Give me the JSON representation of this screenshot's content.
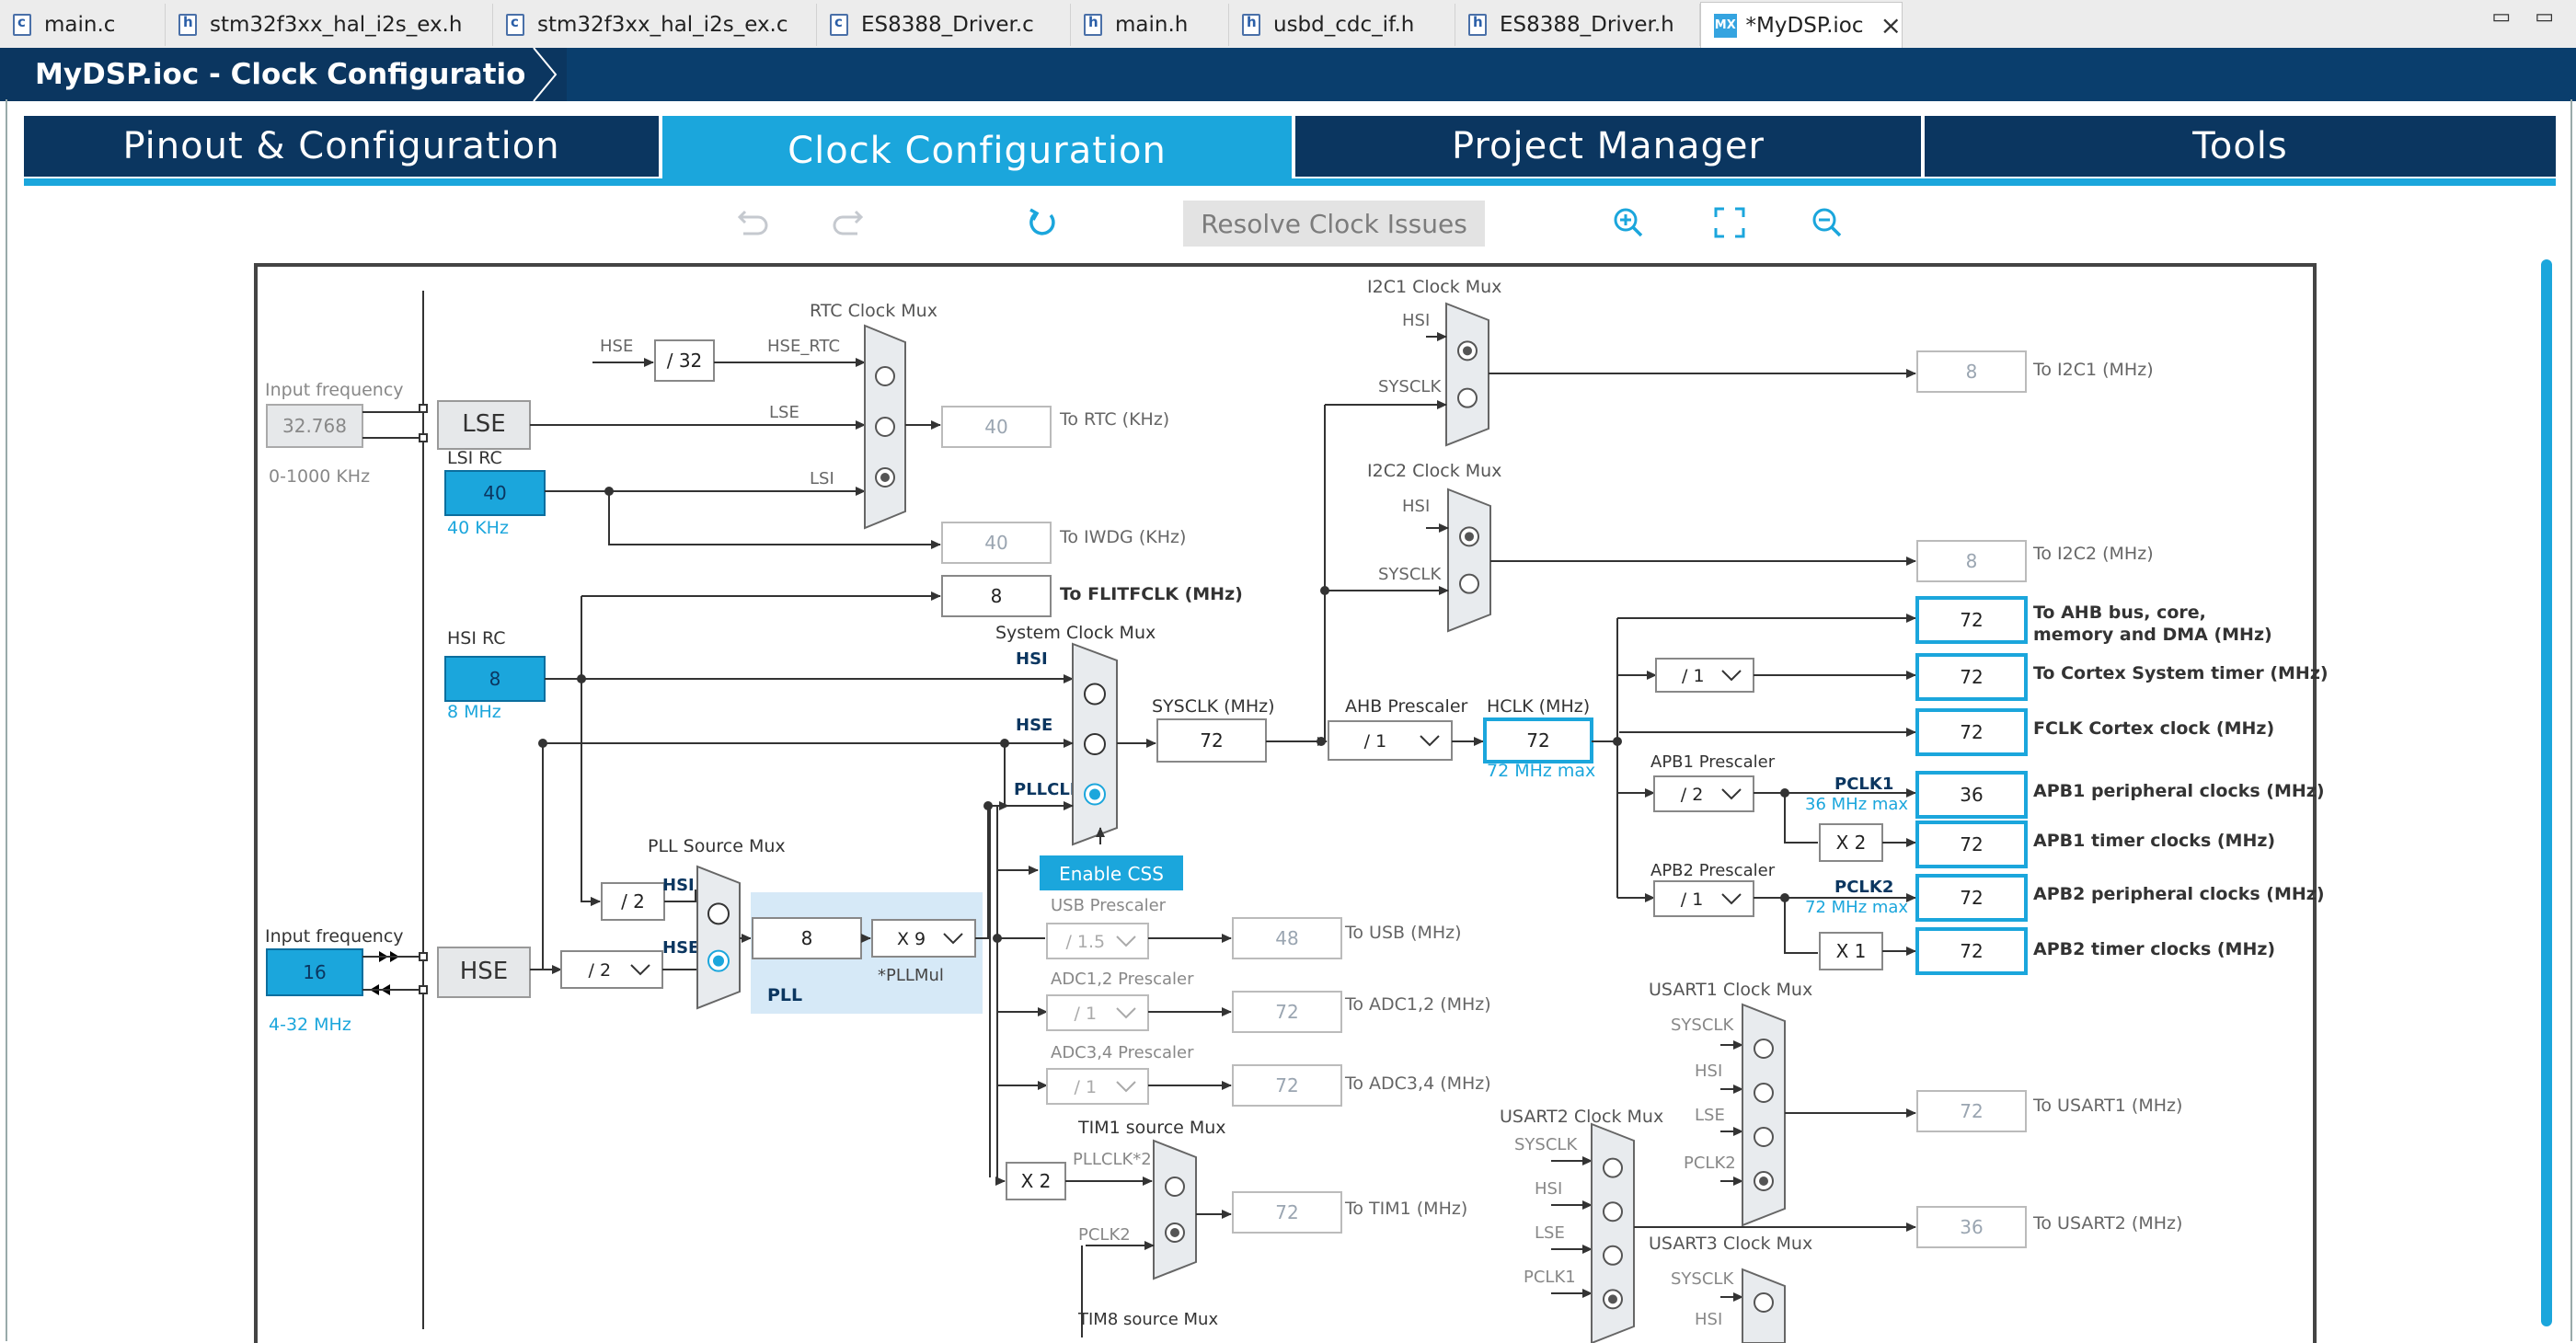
{
  "editor_tabs": [
    {
      "label": "main.c",
      "icon": "c-file-icon"
    },
    {
      "label": "stm32f3xx_hal_i2s_ex.h",
      "icon": "h-file-icon"
    },
    {
      "label": "stm32f3xx_hal_i2s_ex.c",
      "icon": "c-file-icon"
    },
    {
      "label": "ES8388_Driver.c",
      "icon": "c-file-icon"
    },
    {
      "label": "main.h",
      "icon": "h-file-icon"
    },
    {
      "label": "usbd_cdc_if.h",
      "icon": "h-file-icon"
    },
    {
      "label": "ES8388_Driver.h",
      "icon": "h-file-icon"
    },
    {
      "label": "*MyDSP.ioc",
      "icon": "mx-icon",
      "badge": "MX"
    }
  ],
  "breadcrumb": "MyDSP.ioc - Clock Configuration",
  "main_tabs": [
    "Pinout & Configuration",
    "Clock Configuration",
    "Project Manager",
    "Tools"
  ],
  "toolbar": {
    "resolve": "Resolve Clock Issues"
  },
  "colors": {
    "navy": "#0b3660",
    "accent": "#1ba6dc",
    "grey": "#9aa5b1"
  },
  "clock": {
    "input_frequency_label": "Input frequency",
    "lse": {
      "name": "LSE",
      "value": "32.768",
      "range": "0-1000 KHz"
    },
    "lsi": {
      "name": "LSI RC",
      "value": "40",
      "unit": "40 KHz"
    },
    "hsi": {
      "name": "HSI RC",
      "value": "8",
      "unit": "8 MHz"
    },
    "hse": {
      "name": "HSE",
      "value": "16",
      "range": "4-32 MHz"
    },
    "rtc_mux": {
      "title": "RTC Clock Mux",
      "inputs": [
        "HSE_RTC",
        "LSE",
        "LSI"
      ],
      "hse_label": "HSE",
      "div": "/ 32",
      "out_value": "40",
      "out_label": "To RTC (KHz)"
    },
    "iwdg": {
      "value": "40",
      "label": "To IWDG (KHz)"
    },
    "flitf": {
      "value": "8",
      "label": "To FLITFCLK (MHz)"
    },
    "sys_mux": {
      "title": "System Clock Mux",
      "inputs": [
        "HSI",
        "HSE",
        "PLLCLK"
      ]
    },
    "sysclk": {
      "label": "SYSCLK (MHz)",
      "value": "72"
    },
    "ahb": {
      "label": "AHB Prescaler",
      "value": "/ 1"
    },
    "hclk": {
      "label": "HCLK (MHz)",
      "value": "72",
      "max": "72 MHz max"
    },
    "enable_css": "Enable CSS",
    "pll_src": {
      "title": "PLL Source Mux",
      "inputs": [
        "HSI",
        "HSE"
      ],
      "hsi_div": "/ 2",
      "hse_div": "/ 2"
    },
    "pll": {
      "label": "PLL",
      "value": "8",
      "mul": "X 9",
      "mul_label": "*PLLMul"
    },
    "usb": {
      "prescaler_label": "USB Prescaler",
      "prescaler": "/ 1.5",
      "value": "48",
      "label": "To USB (MHz)"
    },
    "adc12": {
      "prescaler_label": "ADC1,2 Prescaler",
      "prescaler": "/ 1",
      "value": "72",
      "label": "To ADC1,2 (MHz)"
    },
    "adc34": {
      "prescaler_label": "ADC3,4 Prescaler",
      "prescaler": "/ 1",
      "value": "72",
      "label": "To ADC3,4 (MHz)"
    },
    "tim1": {
      "title": "TIM1 source Mux",
      "inputs": [
        "PLLCLK*2",
        "PCLK2"
      ],
      "mult": "X 2",
      "value": "72",
      "label": "To TIM1 (MHz)"
    },
    "tim8": {
      "title": "TIM8 source Mux"
    },
    "i2c1": {
      "title": "I2C1 Clock Mux",
      "inputs": [
        "HSI",
        "SYSCLK"
      ],
      "value": "8",
      "label": "To I2C1 (MHz)"
    },
    "i2c2": {
      "title": "I2C2 Clock Mux",
      "inputs": [
        "HSI",
        "SYSCLK"
      ],
      "value": "8",
      "label": "To I2C2 (MHz)"
    },
    "ahb_out": {
      "value": "72",
      "label1": "To AHB bus, core,",
      "label2": "memory and DMA (MHz)"
    },
    "cortex_timer": {
      "div": "/ 1",
      "value": "72",
      "label": "To Cortex System timer (MHz)"
    },
    "fclk": {
      "value": "72",
      "label": "FCLK Cortex clock (MHz)"
    },
    "apb1": {
      "label": "APB1 Prescaler",
      "value": "/ 2",
      "pclk": "PCLK1",
      "max": "36 MHz max",
      "periph_value": "36",
      "periph_label": "APB1 peripheral clocks (MHz)",
      "tim_mult": "X 2",
      "tim_value": "72",
      "tim_label": "APB1 timer clocks (MHz)"
    },
    "apb2": {
      "label": "APB2 Prescaler",
      "value": "/ 1",
      "pclk": "PCLK2",
      "max": "72 MHz max",
      "periph_value": "72",
      "periph_label": "APB2 peripheral clocks (MHz)",
      "tim_mult": "X 1",
      "tim_value": "72",
      "tim_label": "APB2 timer clocks (MHz)"
    },
    "usart1": {
      "title": "USART1 Clock Mux",
      "inputs": [
        "SYSCLK",
        "HSI",
        "LSE",
        "PCLK2"
      ],
      "value": "72",
      "label": "To USART1 (MHz)"
    },
    "usart2": {
      "title": "USART2 Clock Mux",
      "inputs": [
        "SYSCLK",
        "HSI",
        "LSE",
        "PCLK1"
      ],
      "value": "36",
      "label": "To USART2 (MHz)"
    },
    "usart3": {
      "title": "USART3 Clock Mux",
      "inputs": [
        "SYSCLK",
        "HSI"
      ]
    }
  }
}
